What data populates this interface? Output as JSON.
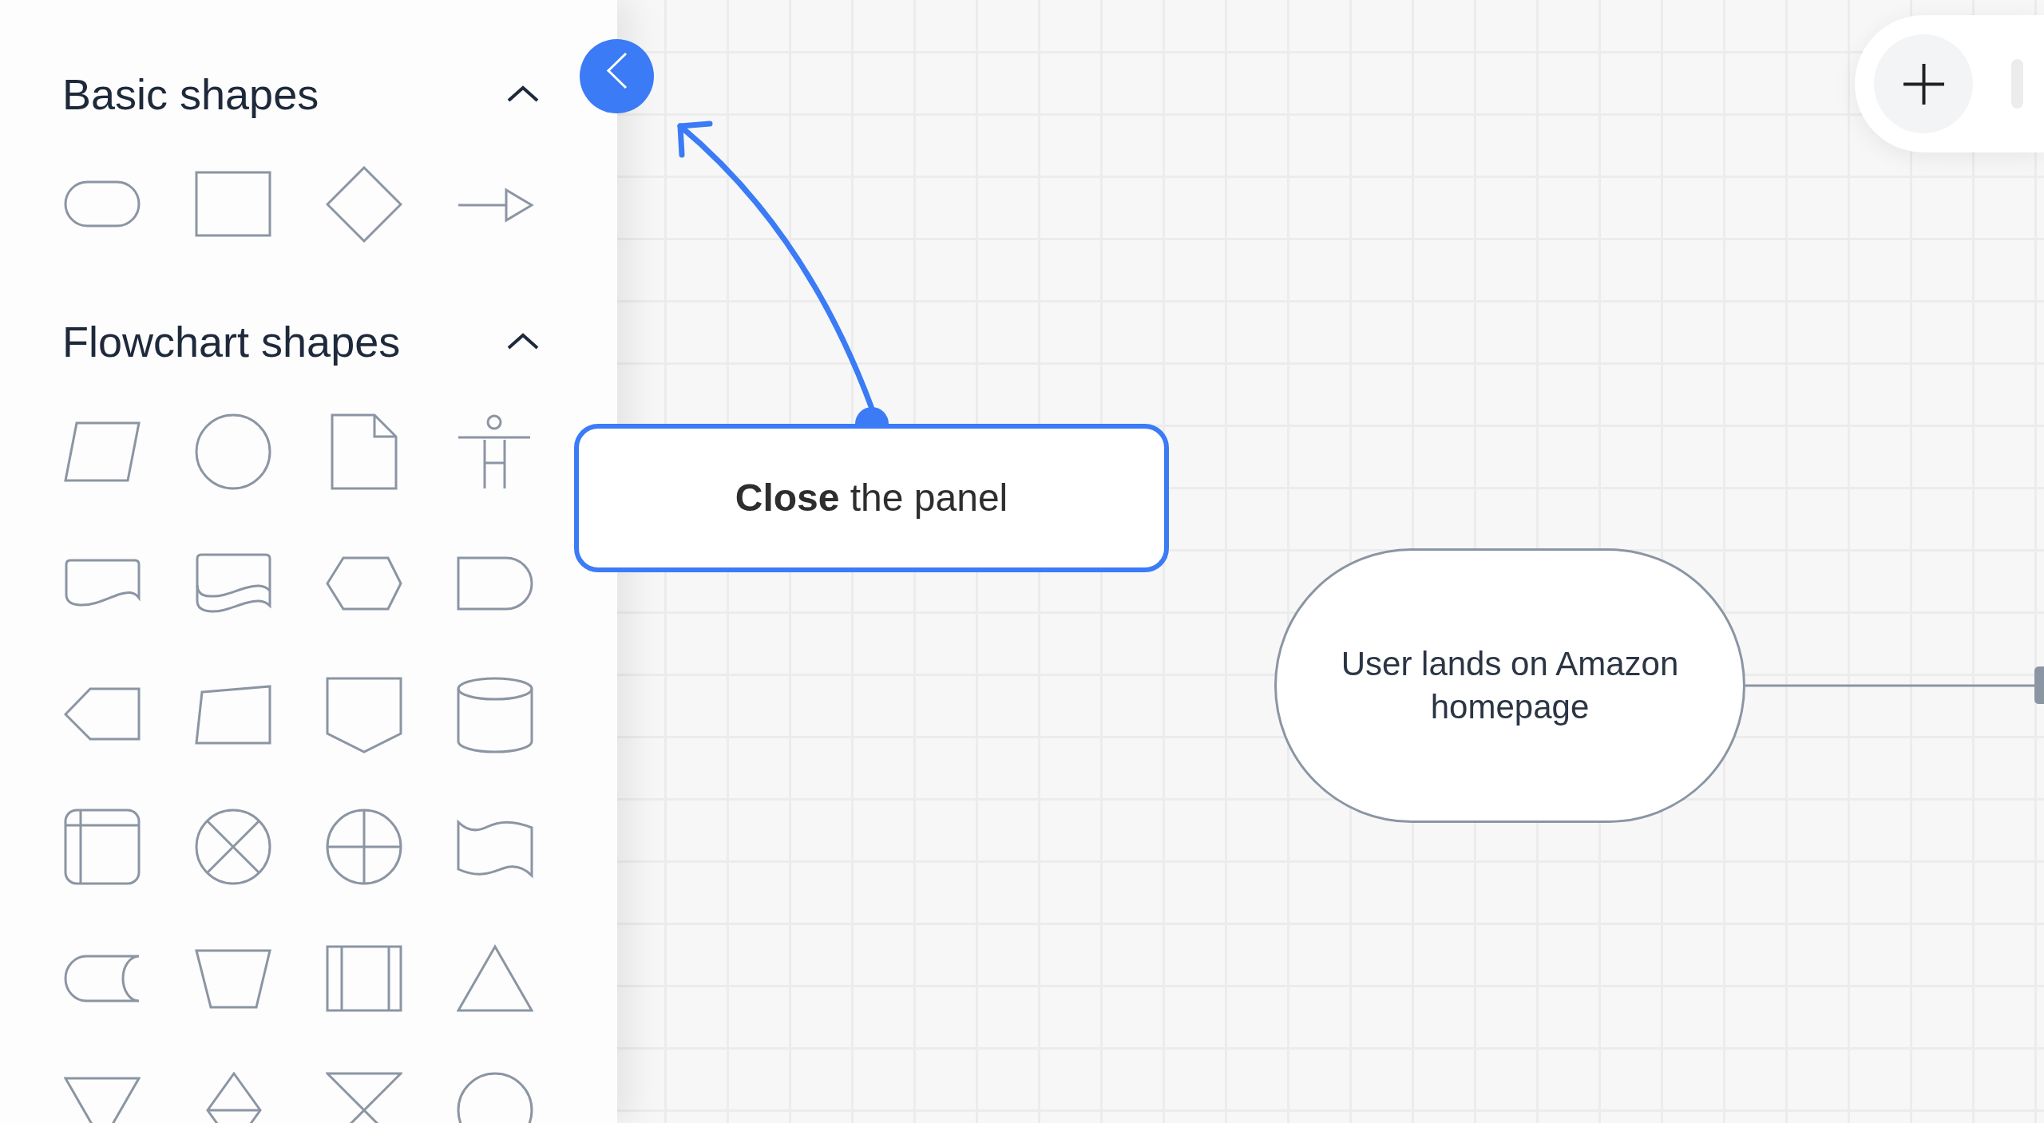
{
  "shapes_panel": {
    "sections": [
      {
        "title": "Basic shapes",
        "expanded": true,
        "shapes": [
          {
            "kind": "terminator"
          },
          {
            "kind": "rectangle"
          },
          {
            "kind": "diamond"
          },
          {
            "kind": "arrow"
          }
        ]
      },
      {
        "title": "Flowchart shapes",
        "expanded": true,
        "shapes": [
          {
            "kind": "parallelogram"
          },
          {
            "kind": "circle"
          },
          {
            "kind": "page"
          },
          {
            "kind": "person"
          },
          {
            "kind": "document"
          },
          {
            "kind": "documents"
          },
          {
            "kind": "hexagon"
          },
          {
            "kind": "delay"
          },
          {
            "kind": "tag"
          },
          {
            "kind": "quadrilateral"
          },
          {
            "kind": "shield"
          },
          {
            "kind": "cylinder"
          },
          {
            "kind": "storage"
          },
          {
            "kind": "xcircle"
          },
          {
            "kind": "pluscircle"
          },
          {
            "kind": "tape"
          },
          {
            "kind": "drum"
          },
          {
            "kind": "trapezoid"
          },
          {
            "kind": "subroutine"
          },
          {
            "kind": "triangle"
          },
          {
            "kind": "invertedtriangle"
          },
          {
            "kind": "sort"
          },
          {
            "kind": "hourglass"
          },
          {
            "kind": "circle"
          }
        ]
      }
    ]
  },
  "callout": {
    "text": "**Close** the panel"
  },
  "canvas": {
    "nodes": [
      {
        "text": "User lands on Amazon homepage"
      }
    ]
  }
}
